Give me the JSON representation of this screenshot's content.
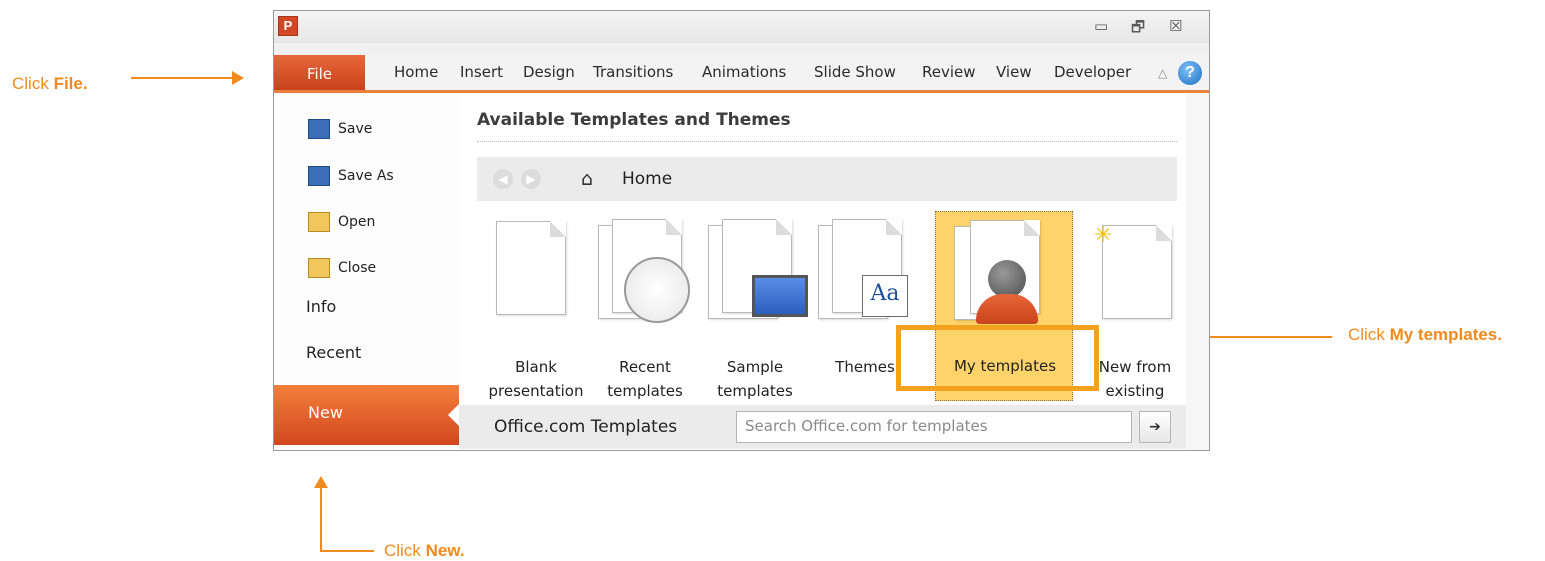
{
  "callouts": {
    "file": {
      "prefix": "Click ",
      "bold": "File."
    },
    "my_templates": {
      "prefix": "Click ",
      "bold": "My templates."
    },
    "new": {
      "prefix": "Click ",
      "bold": "New."
    }
  },
  "window": {
    "app_icon": "P",
    "controls": {
      "minimize": "▭",
      "restore": "🗗",
      "close": "☒"
    }
  },
  "ribbon": {
    "file_tab": "File",
    "tabs": [
      "Home",
      "Insert",
      "Design",
      "Transitions",
      "Animations",
      "Slide Show",
      "Review",
      "View",
      "Developer"
    ],
    "help": "?"
  },
  "backstage": {
    "commands": [
      {
        "label": "Save",
        "icon": "save-icon"
      },
      {
        "label": "Save As",
        "icon": "save-as-icon"
      },
      {
        "label": "Open",
        "icon": "open-folder-icon"
      },
      {
        "label": "Close",
        "icon": "close-folder-icon"
      }
    ],
    "categories": [
      "Info",
      "Recent"
    ],
    "selected": "New"
  },
  "main": {
    "title": "Available Templates and Themes",
    "nav_location": "Home",
    "tiles": [
      {
        "line1": "Blank",
        "line2": "presentation"
      },
      {
        "line1": "Recent",
        "line2": "templates"
      },
      {
        "line1": "Sample",
        "line2": "templates"
      },
      {
        "line1": "Themes",
        "line2": ""
      },
      {
        "line1": "My templates",
        "line2": ""
      },
      {
        "line1": "New from",
        "line2": "existing"
      }
    ],
    "office_label": "Office.com Templates",
    "search_placeholder": "Search Office.com for templates",
    "go": "➔"
  },
  "colors": {
    "accent": "#f08a1c",
    "file_tab": "#d24726",
    "selected_tile": "#fdd36a",
    "highlight": "#f4a21d"
  }
}
